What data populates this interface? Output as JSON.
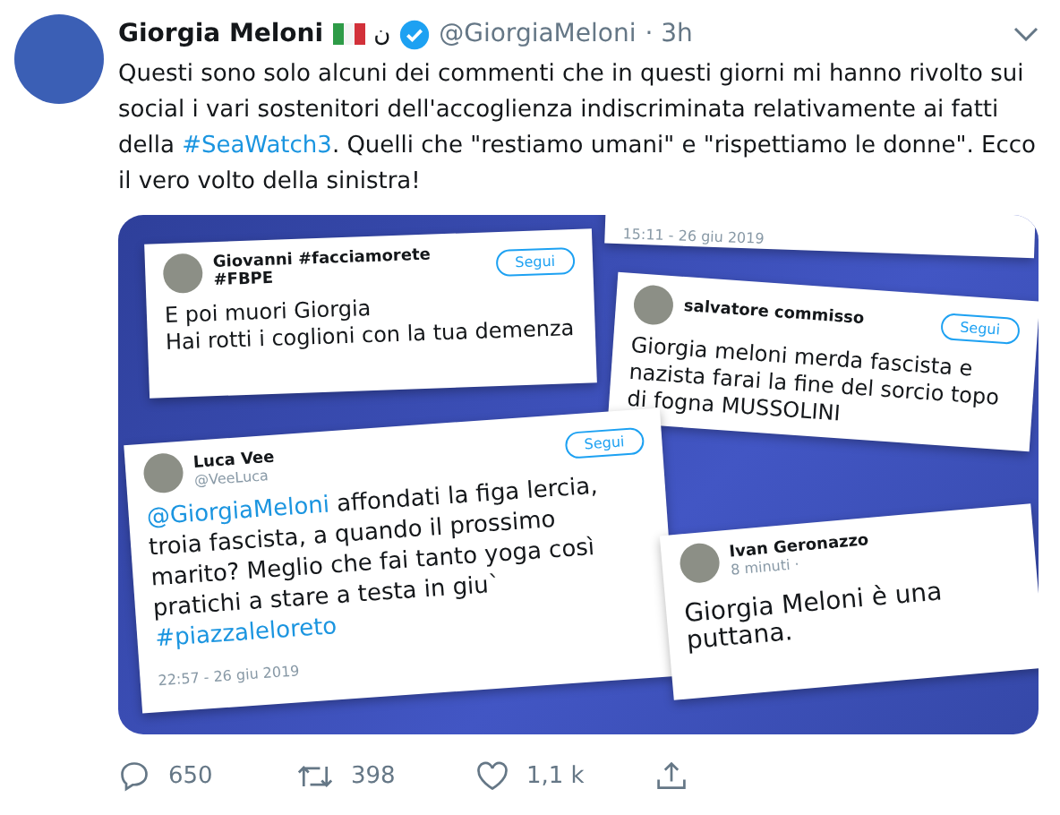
{
  "tweet": {
    "author": {
      "name": "Giorgia Meloni",
      "badge_text": "ن",
      "handle": "@GiorgiaMeloni",
      "time": "· 3h"
    },
    "text": [
      {
        "kind": "plain",
        "text": "Questi sono solo alcuni dei commenti che in questi giorni mi hanno rivolto sui social i vari sostenitori dell'accoglienza indiscriminata relativamente ai fatti della "
      },
      {
        "kind": "link",
        "text": "#SeaWatch3"
      },
      {
        "kind": "plain",
        "text": ". Quelli che \"restiamo umani\" e \"rispettiamo le donne\". Ecco il vero volto della sinistra!"
      }
    ],
    "media": {
      "cards": [
        {
          "kind": "strip",
          "date": "15:11 - 26 giu 2019"
        },
        {
          "kind": "tweet",
          "name": "Giovanni #facciamorete #FBPE",
          "button": "Segui",
          "body": [
            {
              "kind": "plain",
              "text": "E poi muori Giorgia"
            },
            {
              "kind": "break"
            },
            {
              "kind": "plain",
              "text": "Hai rotti i coglioni con la tua demenza"
            }
          ]
        },
        {
          "kind": "tweet",
          "name": "salvatore commisso",
          "button": "Segui",
          "body": [
            {
              "kind": "plain",
              "text": "Giorgia meloni merda fascista e nazista farai la fine del sorcio topo di fogna MUSSOLINI"
            }
          ]
        },
        {
          "kind": "tweet",
          "name": "Luca Vee",
          "handle": "@VeeLuca",
          "button": "Segui",
          "body": [
            {
              "kind": "link",
              "text": "@GiorgiaMeloni"
            },
            {
              "kind": "plain",
              "text": " affondati la figa lercia, troia fascista, a quando il prossimo marito? Meglio che fai tanto yoga così pratichi a stare a testa in giu` "
            },
            {
              "kind": "link",
              "text": "#piazzaleloreto"
            }
          ],
          "date": "22:57 - 26 giu 2019"
        },
        {
          "kind": "facebook",
          "name": "Ivan Geronazzo",
          "time": "8 minuti ·",
          "body": "Giorgia Meloni è una puttana."
        }
      ]
    },
    "actions": [
      {
        "kind": "reply",
        "count": "650"
      },
      {
        "kind": "retweet",
        "count": "398"
      },
      {
        "kind": "like",
        "count": "1,1 k"
      },
      {
        "kind": "share"
      }
    ]
  }
}
